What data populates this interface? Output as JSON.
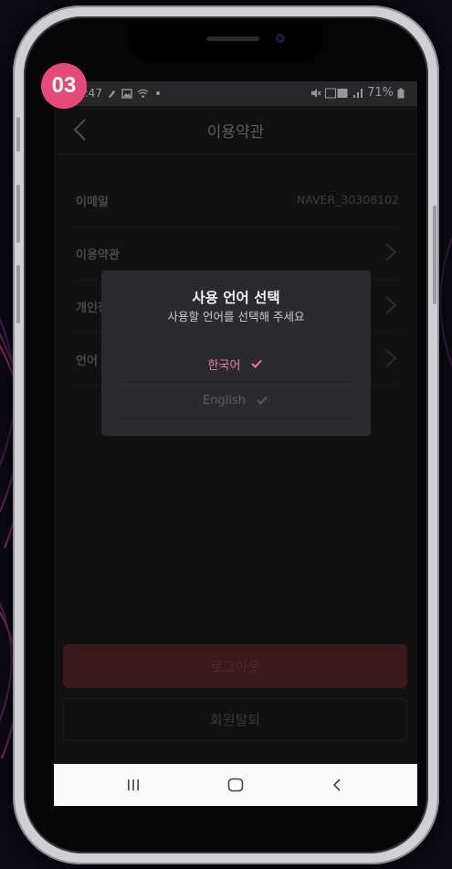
{
  "step_badge": "03",
  "status_bar": {
    "time": "4:47",
    "battery": "71%"
  },
  "header": {
    "title": "이용약관"
  },
  "settings_rows": [
    {
      "label": "이메일",
      "value": "NAVER_30308102"
    },
    {
      "label": "이용약관"
    },
    {
      "label": "개인정보"
    },
    {
      "label": "언어"
    }
  ],
  "buttons": {
    "logout": "로그아웃",
    "withdraw": "회원탈퇴"
  },
  "language_modal": {
    "title": "사용 언어 선택",
    "subtitle": "사용할 언어를 선택해 주세요",
    "options": [
      {
        "label": "한국어",
        "selected": true
      },
      {
        "label": "English",
        "selected": false
      }
    ]
  },
  "colors": {
    "accent": "#f07a97",
    "badge": "#e64a78",
    "logout_button": "#5a262c"
  },
  "icons": {
    "back": "chevron-left-icon",
    "row_arrow": "chevron-right-icon",
    "check": "check-icon",
    "nav_recent": "recent-apps-icon",
    "nav_home": "home-icon",
    "nav_back": "back-icon"
  }
}
